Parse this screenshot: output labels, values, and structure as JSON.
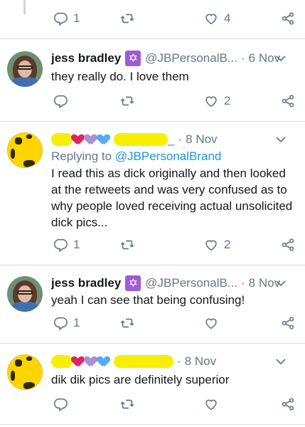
{
  "top_actions": {
    "reply_count": "1",
    "retweet_count": "",
    "like_count": "4"
  },
  "tweets": [
    {
      "name": "jess bradley",
      "badge": "✡",
      "handle": "@JBPersonalB...",
      "time": "6 Nov",
      "text": "they really do. I love them",
      "reply_count": "",
      "like_count": "2"
    },
    {
      "name_suffix": "_",
      "time": "8 Nov",
      "replying_label": "Replying to",
      "replying_to": "@JBPersonalBrand",
      "text": "I read this as dick originally and then looked at the retweets and was very confused as to why people loved receiving actual unsolicited dick pics...",
      "reply_count": "1",
      "like_count": "2"
    },
    {
      "name": "jess bradley",
      "badge": "✡",
      "handle": "@JBPersonalB...",
      "time": "8 Nov",
      "text": "yeah I can see that being confusing!",
      "reply_count": "1",
      "like_count": ""
    },
    {
      "time": "8 Nov",
      "text": "dik dik pics are definitely superior",
      "reply_count": "",
      "like_count": ""
    }
  ],
  "colors": {
    "redaction": "#f6f000",
    "link": "#1b95e0",
    "muted": "#657786",
    "heart_red": "#e0245e",
    "heart_purple": "#aa8ed6",
    "heart_blue": "#55acee"
  },
  "icons": [
    "reply-icon",
    "retweet-icon",
    "like-icon",
    "share-icon",
    "chevron-down-icon"
  ]
}
